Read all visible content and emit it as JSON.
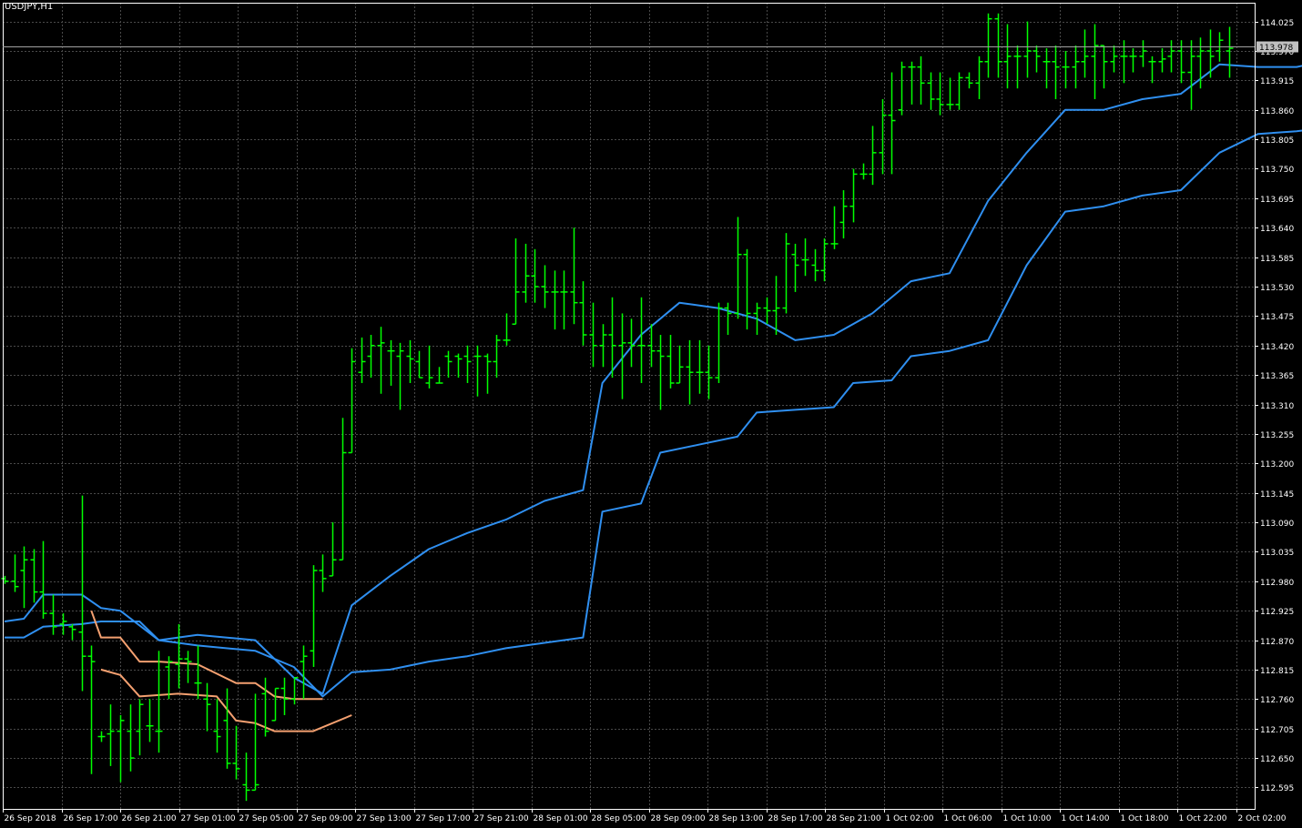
{
  "window": {
    "title": "USDJPY,H1"
  },
  "colors": {
    "background": "#000000",
    "grid": "#4a4a4a",
    "axis": "#ffffff",
    "bar": "#00ff00",
    "line_blue": "#2f8ff0",
    "line_orange": "#f4a070",
    "bid_line": "#a0a0a0",
    "price_tag_bg": "#c0c0c0",
    "price_tag_text": "#000000"
  },
  "chart_data": {
    "type": "ohlc",
    "symbol": "USDJPY",
    "timeframe": "H1",
    "grid": true,
    "ylim": [
      112.555,
      114.06
    ],
    "y_ticks": [
      "114.025",
      "113.970",
      "113.915",
      "113.860",
      "113.805",
      "113.750",
      "113.695",
      "113.640",
      "113.585",
      "113.530",
      "113.475",
      "113.420",
      "113.365",
      "113.310",
      "113.255",
      "113.200",
      "113.145",
      "113.090",
      "113.035",
      "112.980",
      "112.925",
      "112.870",
      "112.815",
      "112.760",
      "112.705",
      "112.650",
      "112.595"
    ],
    "x_ticks": [
      "26 Sep 2018",
      "26 Sep 17:00",
      "26 Sep 21:00",
      "27 Sep 01:00",
      "27 Sep 05:00",
      "27 Sep 09:00",
      "27 Sep 13:00",
      "27 Sep 17:00",
      "27 Sep 21:00",
      "28 Sep 01:00",
      "28 Sep 05:00",
      "28 Sep 09:00",
      "28 Sep 13:00",
      "28 Sep 17:00",
      "28 Sep 21:00",
      "1 Oct 02:00",
      "1 Oct 06:00",
      "1 Oct 10:00",
      "1 Oct 14:00",
      "1 Oct 18:00",
      "1 Oct 22:00",
      "2 Oct 02:00"
    ],
    "current_price": "113.978",
    "bars": [
      [
        112.985,
        112.99,
        112.975,
        112.98
      ],
      [
        112.98,
        113.03,
        112.96,
        112.97
      ],
      [
        113.0,
        113.045,
        112.93,
        113.02
      ],
      [
        113.02,
        113.04,
        112.94,
        112.96
      ],
      [
        112.96,
        113.055,
        112.91,
        112.92
      ],
      [
        112.92,
        112.955,
        112.88,
        112.895
      ],
      [
        112.9,
        112.92,
        112.88,
        112.905
      ],
      [
        112.895,
        112.9,
        112.87,
        112.89
      ],
      [
        112.885,
        113.14,
        112.775,
        112.84
      ],
      [
        112.84,
        112.86,
        112.62,
        112.83
      ],
      [
        112.69,
        112.7,
        112.68,
        112.69
      ],
      [
        112.695,
        112.75,
        112.635,
        112.7
      ],
      [
        112.7,
        112.73,
        112.605,
        112.72
      ],
      [
        112.7,
        112.75,
        112.625,
        112.65
      ],
      [
        112.7,
        112.76,
        112.655,
        112.75
      ],
      [
        112.71,
        112.76,
        112.68,
        112.71
      ],
      [
        112.7,
        112.85,
        112.66,
        112.7
      ],
      [
        112.82,
        112.84,
        112.76,
        112.83
      ],
      [
        112.825,
        112.9,
        112.78,
        112.835
      ],
      [
        112.835,
        112.85,
        112.79,
        112.83
      ],
      [
        112.79,
        112.86,
        112.76,
        112.79
      ],
      [
        112.76,
        112.79,
        112.7,
        112.75
      ],
      [
        112.7,
        112.76,
        112.66,
        112.69
      ],
      [
        112.72,
        112.78,
        112.63,
        112.64
      ],
      [
        112.64,
        112.71,
        112.61,
        112.63
      ],
      [
        112.6,
        112.66,
        112.57,
        112.59
      ],
      [
        112.59,
        112.77,
        112.59,
        112.6
      ],
      [
        112.77,
        112.8,
        112.69,
        112.7
      ],
      [
        112.72,
        112.78,
        112.72,
        112.78
      ],
      [
        112.78,
        112.8,
        112.73,
        112.76
      ],
      [
        112.76,
        112.8,
        112.75,
        112.8
      ],
      [
        112.83,
        112.86,
        112.76,
        112.84
      ],
      [
        112.85,
        113.01,
        112.82,
        113.0
      ],
      [
        113.0,
        113.03,
        112.96,
        112.985
      ],
      [
        112.99,
        113.09,
        112.99,
        113.02
      ],
      [
        113.02,
        113.285,
        113.02,
        113.22
      ],
      [
        113.22,
        113.415,
        113.22,
        113.39
      ],
      [
        113.37,
        113.435,
        113.35,
        113.39
      ],
      [
        113.4,
        113.44,
        113.36,
        113.42
      ],
      [
        113.42,
        113.455,
        113.33,
        113.425
      ],
      [
        113.41,
        113.43,
        113.345,
        113.41
      ],
      [
        113.4,
        113.425,
        113.3,
        113.41
      ],
      [
        113.4,
        113.43,
        113.35,
        113.395
      ],
      [
        113.39,
        113.41,
        113.36,
        113.36
      ],
      [
        113.35,
        113.42,
        113.34,
        113.36
      ],
      [
        113.35,
        113.38,
        113.35,
        113.35
      ],
      [
        113.4,
        113.41,
        113.36,
        113.39
      ],
      [
        113.4,
        113.405,
        113.36,
        113.395
      ],
      [
        113.4,
        113.42,
        113.35,
        113.39
      ],
      [
        113.4,
        113.42,
        113.325,
        113.4
      ],
      [
        113.4,
        113.405,
        113.33,
        113.39
      ],
      [
        113.39,
        113.44,
        113.36,
        113.43
      ],
      [
        113.43,
        113.48,
        113.42,
        113.43
      ],
      [
        113.46,
        113.62,
        113.46,
        113.52
      ],
      [
        113.52,
        113.61,
        113.5,
        113.55
      ],
      [
        113.55,
        113.6,
        113.5,
        113.53
      ],
      [
        113.53,
        113.57,
        113.49,
        113.52
      ],
      [
        113.52,
        113.56,
        113.45,
        113.52
      ],
      [
        113.52,
        113.56,
        113.45,
        113.52
      ],
      [
        113.52,
        113.64,
        113.46,
        113.5
      ],
      [
        113.5,
        113.54,
        113.42,
        113.44
      ],
      [
        113.44,
        113.5,
        113.38,
        113.42
      ],
      [
        113.42,
        113.46,
        113.38,
        113.44
      ],
      [
        113.44,
        113.51,
        113.36,
        113.42
      ],
      [
        113.42,
        113.48,
        113.32,
        113.425
      ],
      [
        113.425,
        113.47,
        113.38,
        113.42
      ],
      [
        113.42,
        113.51,
        113.35,
        113.42
      ],
      [
        113.42,
        113.46,
        113.38,
        113.41
      ],
      [
        113.41,
        113.44,
        113.3,
        113.4
      ],
      [
        113.4,
        113.44,
        113.34,
        113.35
      ],
      [
        113.35,
        113.42,
        113.35,
        113.38
      ],
      [
        113.38,
        113.43,
        113.31,
        113.37
      ],
      [
        113.37,
        113.43,
        113.33,
        113.37
      ],
      [
        113.37,
        113.42,
        113.32,
        113.36
      ],
      [
        113.36,
        113.5,
        113.35,
        113.49
      ],
      [
        113.49,
        113.5,
        113.44,
        113.48
      ],
      [
        113.48,
        113.66,
        113.47,
        113.59
      ],
      [
        113.59,
        113.6,
        113.45,
        113.48
      ],
      [
        113.48,
        113.5,
        113.44,
        113.49
      ],
      [
        113.49,
        113.51,
        113.46,
        113.485
      ],
      [
        113.485,
        113.55,
        113.44,
        113.49
      ],
      [
        113.49,
        113.63,
        113.48,
        113.61
      ],
      [
        113.59,
        113.61,
        113.52,
        113.57
      ],
      [
        113.58,
        113.62,
        113.55,
        113.58
      ],
      [
        113.57,
        113.6,
        113.54,
        113.56
      ],
      [
        113.56,
        113.62,
        113.54,
        113.61
      ],
      [
        113.61,
        113.68,
        113.6,
        113.61
      ],
      [
        113.65,
        113.71,
        113.62,
        113.68
      ],
      [
        113.68,
        113.75,
        113.65,
        113.74
      ],
      [
        113.74,
        113.76,
        113.73,
        113.74
      ],
      [
        113.74,
        113.83,
        113.72,
        113.78
      ],
      [
        113.78,
        113.88,
        113.74,
        113.85
      ],
      [
        113.85,
        113.93,
        113.74,
        113.84
      ],
      [
        113.86,
        113.95,
        113.85,
        113.94
      ],
      [
        113.94,
        113.95,
        113.87,
        113.94
      ],
      [
        113.94,
        113.96,
        113.87,
        113.91
      ],
      [
        113.91,
        113.93,
        113.86,
        113.88
      ],
      [
        113.88,
        113.93,
        113.85,
        113.87
      ],
      [
        113.87,
        113.92,
        113.86,
        113.87
      ],
      [
        113.87,
        113.93,
        113.86,
        113.92
      ],
      [
        113.92,
        113.93,
        113.9,
        113.91
      ],
      [
        113.91,
        113.96,
        113.88,
        113.95
      ],
      [
        113.95,
        114.04,
        113.92,
        114.03
      ],
      [
        114.03,
        114.04,
        113.92,
        113.95
      ],
      [
        113.95,
        114.02,
        113.9,
        113.96
      ],
      [
        113.96,
        113.98,
        113.9,
        113.96
      ],
      [
        113.96,
        114.025,
        113.92,
        113.97
      ],
      [
        113.97,
        113.98,
        113.93,
        113.96
      ],
      [
        113.95,
        113.975,
        113.9,
        113.95
      ],
      [
        113.95,
        113.98,
        113.88,
        113.94
      ],
      [
        113.94,
        113.97,
        113.9,
        113.94
      ],
      [
        113.94,
        113.98,
        113.9,
        113.95
      ],
      [
        113.95,
        114.01,
        113.92,
        113.96
      ],
      [
        113.96,
        114.02,
        113.88,
        113.98
      ],
      [
        113.98,
        113.98,
        113.9,
        113.95
      ],
      [
        113.95,
        113.98,
        113.93,
        113.96
      ],
      [
        113.96,
        113.99,
        113.91,
        113.96
      ],
      [
        113.96,
        113.975,
        113.93,
        113.96
      ],
      [
        113.96,
        113.99,
        113.94,
        113.97
      ],
      [
        113.95,
        113.96,
        113.91,
        113.95
      ],
      [
        113.95,
        113.975,
        113.93,
        113.955
      ],
      [
        113.96,
        113.99,
        113.93,
        113.97
      ],
      [
        113.97,
        113.99,
        113.91,
        113.93
      ],
      [
        113.93,
        113.99,
        113.86,
        113.96
      ],
      [
        113.96,
        113.995,
        113.9,
        113.97
      ],
      [
        113.97,
        114.01,
        113.92,
        113.96
      ],
      [
        113.97,
        114.005,
        113.95,
        113.99
      ],
      [
        113.97,
        114.015,
        113.92,
        113.975
      ]
    ],
    "series": [
      {
        "color": "blue",
        "points": [
          [
            0,
            112.905
          ],
          [
            2,
            112.91
          ],
          [
            4,
            112.955
          ],
          [
            8,
            112.955
          ],
          [
            10,
            112.93
          ],
          [
            12,
            112.925
          ],
          [
            16,
            112.87
          ],
          [
            20,
            112.88
          ],
          [
            26,
            112.87
          ],
          [
            30,
            112.8
          ],
          [
            33,
            112.77
          ],
          [
            36,
            112.935
          ],
          [
            40,
            112.99
          ],
          [
            44,
            113.04
          ],
          [
            48,
            113.07
          ],
          [
            52,
            113.095
          ],
          [
            56,
            113.13
          ],
          [
            60,
            113.15
          ],
          [
            62,
            113.35
          ],
          [
            66,
            113.44
          ],
          [
            70,
            113.5
          ],
          [
            74,
            113.49
          ],
          [
            78,
            113.47
          ],
          [
            82,
            113.43
          ],
          [
            86,
            113.44
          ],
          [
            90,
            113.48
          ],
          [
            94,
            113.54
          ],
          [
            98,
            113.555
          ],
          [
            102,
            113.69
          ],
          [
            106,
            113.78
          ],
          [
            110,
            113.86
          ],
          [
            114,
            113.86
          ],
          [
            118,
            113.88
          ],
          [
            122,
            113.89
          ],
          [
            126,
            113.945
          ],
          [
            130,
            113.94
          ],
          [
            134,
            113.94
          ],
          [
            138,
            113.955
          ],
          [
            142,
            113.955
          ],
          [
            146,
            113.93
          ],
          [
            150,
            113.955
          ],
          [
            154,
            113.96
          ]
        ]
      },
      {
        "color": "blue",
        "points": [
          [
            0,
            112.875
          ],
          [
            2,
            112.875
          ],
          [
            4,
            112.895
          ],
          [
            8,
            112.9
          ],
          [
            10,
            112.905
          ],
          [
            14,
            112.905
          ],
          [
            16,
            112.87
          ],
          [
            20,
            112.86
          ],
          [
            26,
            112.85
          ],
          [
            30,
            112.82
          ],
          [
            33,
            112.765
          ],
          [
            36,
            112.81
          ],
          [
            40,
            112.815
          ],
          [
            44,
            112.83
          ],
          [
            48,
            112.84
          ],
          [
            52,
            112.855
          ],
          [
            56,
            112.865
          ],
          [
            60,
            112.875
          ],
          [
            62,
            113.11
          ],
          [
            66,
            113.125
          ],
          [
            68,
            113.22
          ],
          [
            72,
            113.235
          ],
          [
            76,
            113.25
          ],
          [
            78,
            113.295
          ],
          [
            82,
            113.3
          ],
          [
            86,
            113.305
          ],
          [
            88,
            113.35
          ],
          [
            92,
            113.355
          ],
          [
            94,
            113.4
          ],
          [
            98,
            113.41
          ],
          [
            102,
            113.43
          ],
          [
            106,
            113.57
          ],
          [
            110,
            113.67
          ],
          [
            114,
            113.68
          ],
          [
            118,
            113.7
          ],
          [
            122,
            113.71
          ],
          [
            126,
            113.78
          ],
          [
            130,
            113.815
          ],
          [
            134,
            113.82
          ],
          [
            138,
            113.83
          ],
          [
            142,
            113.865
          ],
          [
            146,
            113.87
          ],
          [
            150,
            113.875
          ],
          [
            154,
            113.915
          ]
        ]
      },
      {
        "color": "orange",
        "points": [
          [
            9,
            112.925
          ],
          [
            10,
            112.875
          ],
          [
            12,
            112.875
          ],
          [
            14,
            112.83
          ],
          [
            16,
            112.83
          ],
          [
            20,
            112.825
          ],
          [
            24,
            112.79
          ],
          [
            26,
            112.79
          ],
          [
            28,
            112.765
          ],
          [
            30,
            112.76
          ],
          [
            33,
            112.76
          ]
        ]
      },
      {
        "color": "orange",
        "points": [
          [
            10,
            112.815
          ],
          [
            12,
            112.805
          ],
          [
            14,
            112.765
          ],
          [
            18,
            112.77
          ],
          [
            22,
            112.765
          ],
          [
            24,
            112.72
          ],
          [
            26,
            112.715
          ],
          [
            28,
            112.7
          ],
          [
            32,
            112.7
          ],
          [
            36,
            112.73
          ]
        ]
      }
    ]
  }
}
